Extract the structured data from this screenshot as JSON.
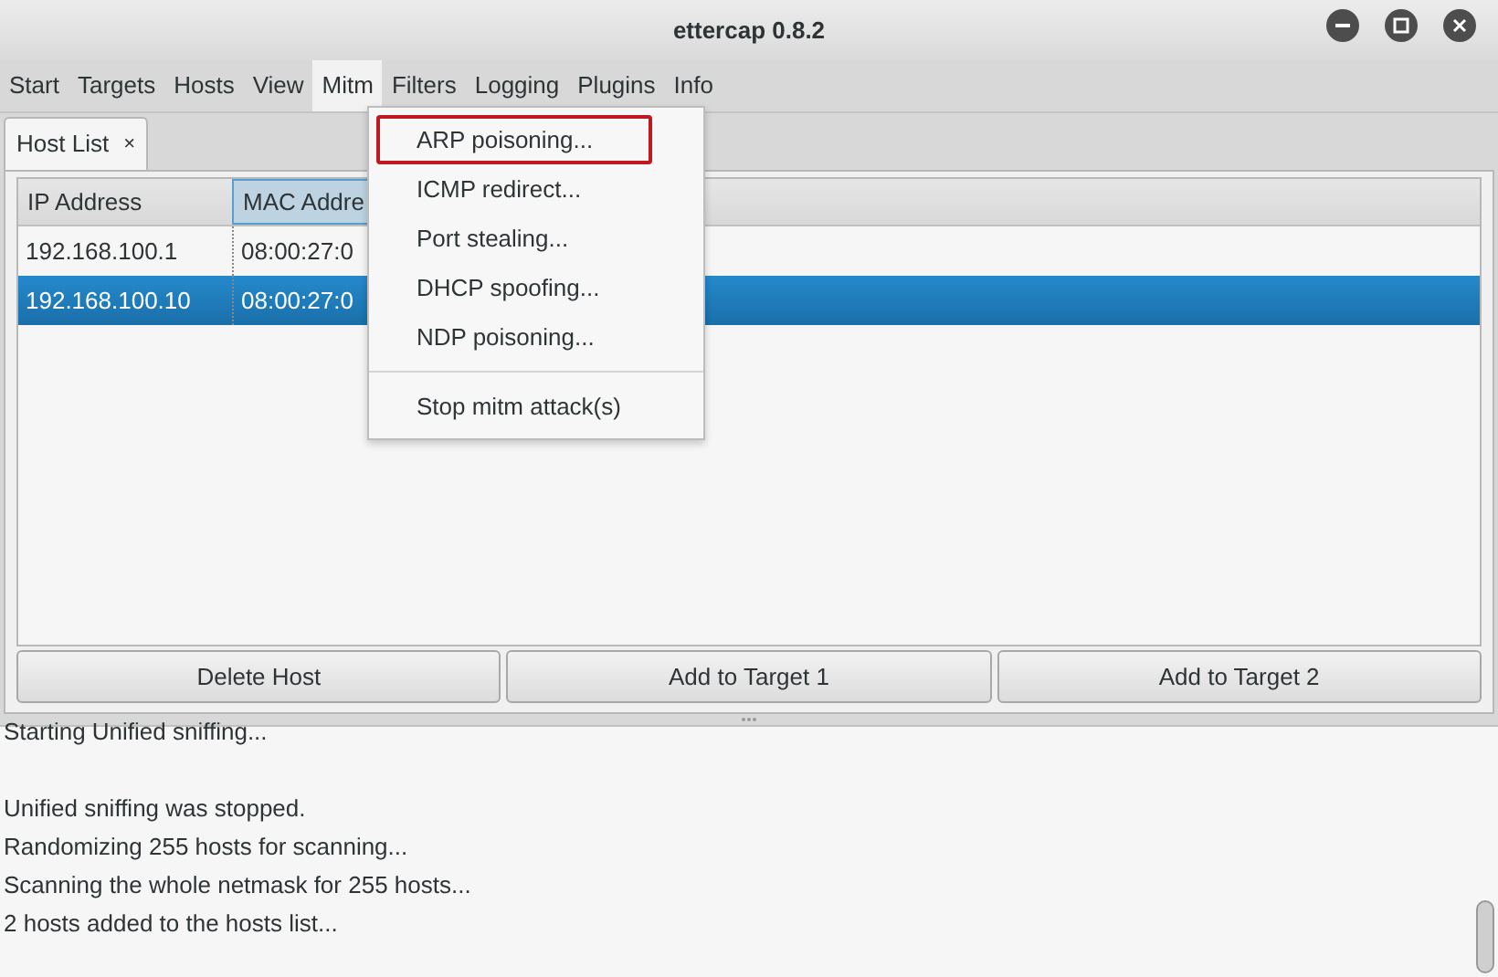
{
  "window": {
    "title": "ettercap 0.8.2"
  },
  "menubar": [
    {
      "label": "Start",
      "selected": false
    },
    {
      "label": "Targets",
      "selected": false
    },
    {
      "label": "Hosts",
      "selected": false
    },
    {
      "label": "View",
      "selected": false
    },
    {
      "label": "Mitm",
      "selected": true
    },
    {
      "label": "Filters",
      "selected": false
    },
    {
      "label": "Logging",
      "selected": false
    },
    {
      "label": "Plugins",
      "selected": false
    },
    {
      "label": "Info",
      "selected": false
    }
  ],
  "tabs": [
    {
      "label": "Host List",
      "close": "×",
      "selected": true
    }
  ],
  "table": {
    "columns": [
      {
        "label": "IP Address",
        "selected": false
      },
      {
        "label": "MAC Addre",
        "selected": true
      }
    ],
    "rows": [
      {
        "cells": [
          "192.168.100.1",
          "08:00:27:0"
        ],
        "selected": false
      },
      {
        "cells": [
          "192.168.100.10",
          "08:00:27:0"
        ],
        "selected": true
      }
    ]
  },
  "buttons": [
    "Delete Host",
    "Add to Target 1",
    "Add to Target 2"
  ],
  "log": [
    {
      "kind": "line",
      "text": "Starting Unified sniffing..."
    },
    {
      "kind": "blank"
    },
    {
      "kind": "line",
      "text": "Unified sniffing was stopped."
    },
    {
      "kind": "line",
      "text": "Randomizing 255 hosts for scanning..."
    },
    {
      "kind": "line",
      "text": "Scanning the whole netmask for 255 hosts..."
    },
    {
      "kind": "line",
      "text": "2 hosts added to the hosts list..."
    }
  ],
  "mitm_menu": [
    {
      "kind": "item",
      "label": "ARP poisoning...",
      "outlined": true
    },
    {
      "kind": "item",
      "label": "ICMP redirect...",
      "outlined": false
    },
    {
      "kind": "item",
      "label": "Port stealing...",
      "outlined": false
    },
    {
      "kind": "item",
      "label": "DHCP spoofing...",
      "outlined": false
    },
    {
      "kind": "item",
      "label": "NDP poisoning...",
      "outlined": false
    },
    {
      "kind": "separator"
    },
    {
      "kind": "item",
      "label": "Stop mitm attack(s)",
      "outlined": false
    }
  ]
}
